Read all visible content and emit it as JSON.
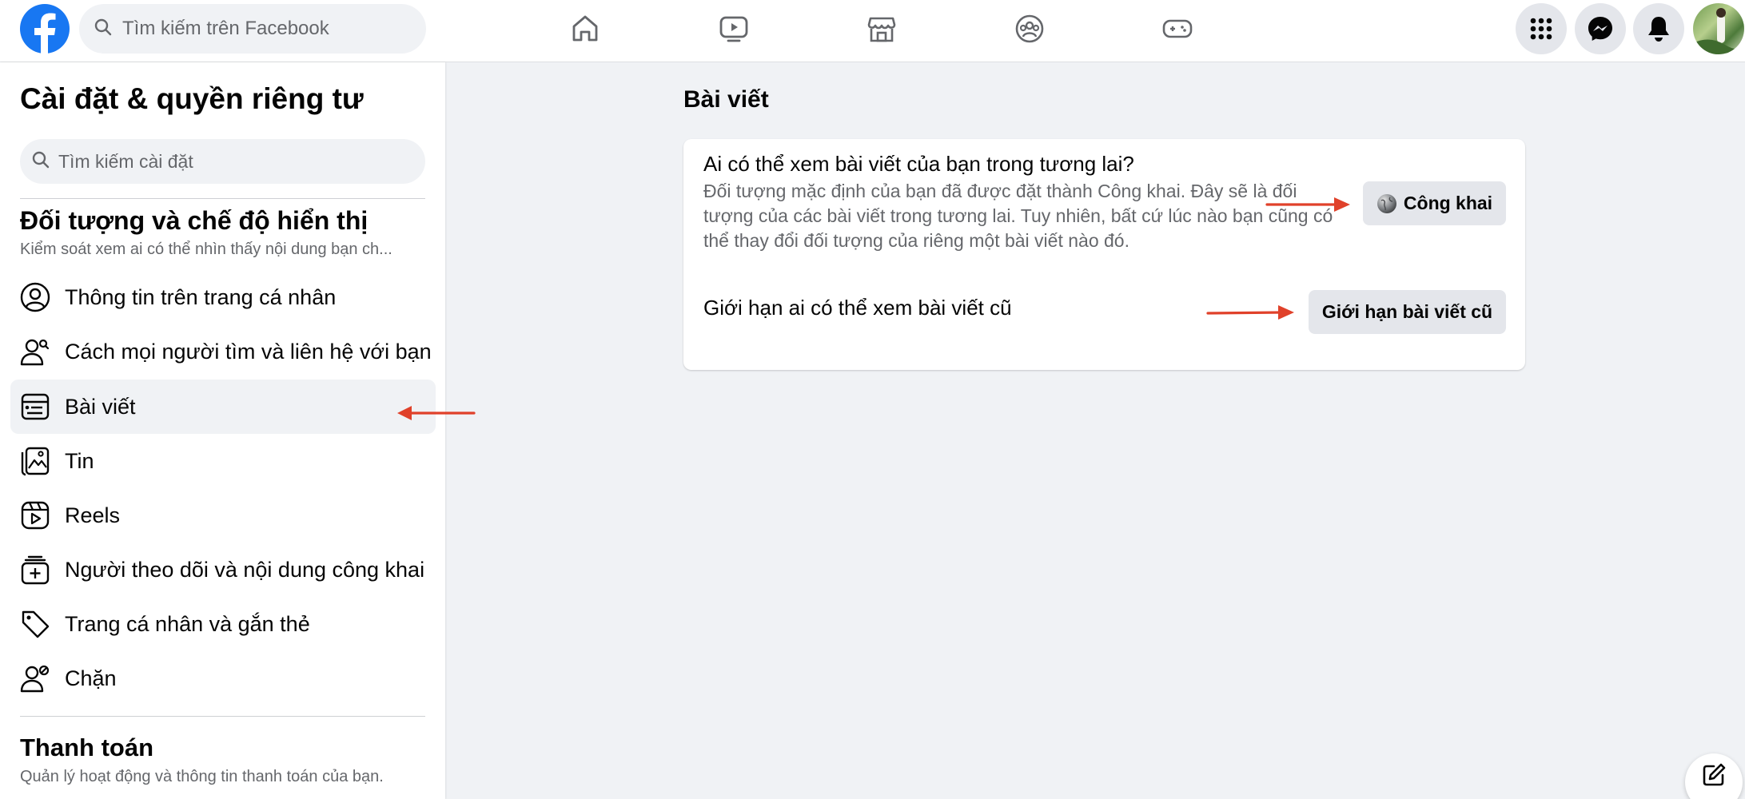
{
  "topbar": {
    "search_placeholder": "Tìm kiếm trên Facebook",
    "brand_color": "#1877f2",
    "nav_icons": [
      "home-icon",
      "video-icon",
      "marketplace-icon",
      "groups-icon",
      "gaming-icon"
    ],
    "action_icons": [
      "menu-grid-icon",
      "messenger-icon",
      "notifications-icon",
      "avatar"
    ]
  },
  "sidebar": {
    "title": "Cài đặt & quyền riêng tư",
    "search_placeholder": "Tìm kiếm cài đặt",
    "section1": {
      "title": "Đối tượng và chế độ hiển thị",
      "subtitle": "Kiểm soát xem ai có thể nhìn thấy nội dung bạn ch..."
    },
    "items": [
      {
        "label": "Thông tin trên trang cá nhân",
        "icon": "profile-icon"
      },
      {
        "label": "Cách mọi người tìm và liên hệ với bạn",
        "icon": "people-search-icon"
      },
      {
        "label": "Bài viết",
        "icon": "posts-icon",
        "active": true
      },
      {
        "label": "Tin",
        "icon": "stories-icon"
      },
      {
        "label": "Reels",
        "icon": "reels-icon"
      },
      {
        "label": "Người theo dõi và nội dung công khai",
        "icon": "followers-icon"
      },
      {
        "label": "Trang cá nhân và gắn thẻ",
        "icon": "tag-icon"
      },
      {
        "label": "Chặn",
        "icon": "block-icon"
      }
    ],
    "section2": {
      "title": "Thanh toán",
      "subtitle": "Quản lý hoạt động và thông tin thanh toán của bạn."
    }
  },
  "main": {
    "title": "Bài viết",
    "future_posts": {
      "question": "Ai có thể xem bài viết của bạn trong tương lai?",
      "description": "Đối tượng mặc định của bạn đã được đặt thành Công khai. Đây sẽ là đối tượng của các bài viết trong tương lai. Tuy nhiên, bất cứ lúc nào bạn cũng có thể thay đổi đối tượng của riêng một bài viết nào đó.",
      "button_label": "Công khai",
      "button_icon": "globe-icon"
    },
    "limit_past": {
      "label": "Giới hạn ai có thể xem bài viết cũ",
      "button_label": "Giới hạn bài viết cũ"
    }
  },
  "annotation_color": "#e0412a"
}
